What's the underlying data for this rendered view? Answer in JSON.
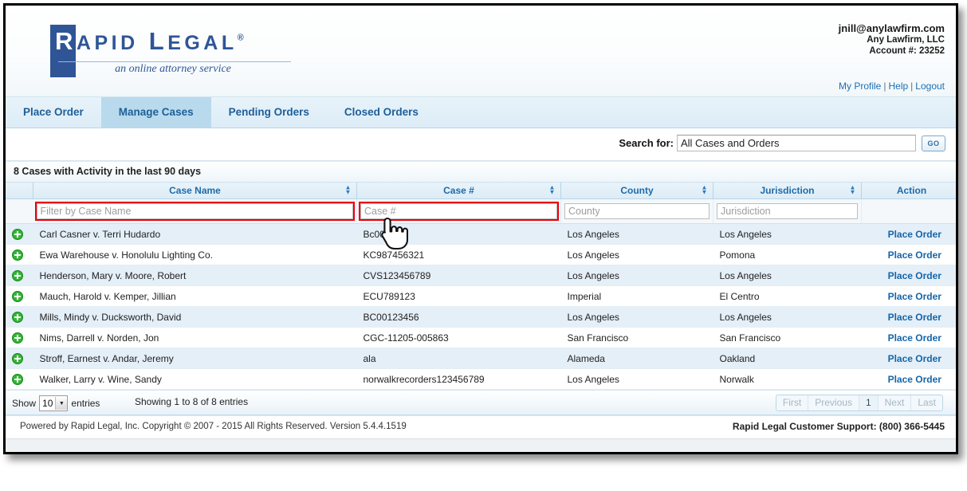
{
  "account": {
    "email": "jnill@anylawfirm.com",
    "firm": "Any Lawfirm, LLC",
    "account_number": "Account #: 23252",
    "links": [
      {
        "label": "My Profile"
      },
      {
        "label": "Help"
      },
      {
        "label": "Logout"
      }
    ],
    "separator": "|"
  },
  "brand": {
    "name_part1": "R",
    "name_part2": "APID",
    "name_part3": "L",
    "name_part4": "EGAL",
    "registered": "®",
    "tagline": "an online attorney service",
    "primary_color": "#2f5597"
  },
  "tabs": [
    {
      "label": "Place Order",
      "active": false
    },
    {
      "label": "Manage Cases",
      "active": true
    },
    {
      "label": "Pending Orders",
      "active": false
    },
    {
      "label": "Closed Orders",
      "active": false
    }
  ],
  "search": {
    "label": "Search for:",
    "value": "All Cases and Orders",
    "placeholder": "All Cases and Orders",
    "button_label": "GO"
  },
  "panel": {
    "title": "8 Cases with Activity in the last 90 days"
  },
  "table": {
    "columns": [
      {
        "key": "expand",
        "label": "",
        "sortable": false
      },
      {
        "key": "case_name",
        "label": "Case Name",
        "sortable": true
      },
      {
        "key": "case_number",
        "label": "Case #",
        "sortable": true
      },
      {
        "key": "county",
        "label": "County",
        "sortable": true
      },
      {
        "key": "jurisdiction",
        "label": "Jurisdiction",
        "sortable": true
      },
      {
        "key": "action",
        "label": "Action",
        "sortable": false
      }
    ],
    "filters": [
      {
        "key": "case_name",
        "placeholder": "Filter by Case Name",
        "value": "",
        "highlighted": true
      },
      {
        "key": "case_number",
        "placeholder": "Case #",
        "value": "",
        "highlighted": true
      },
      {
        "key": "county",
        "placeholder": "County",
        "value": "",
        "highlighted": false
      },
      {
        "key": "jurisdiction",
        "placeholder": "Jurisdiction",
        "value": "",
        "highlighted": false
      }
    ],
    "action_label": "Place Order",
    "rows": [
      {
        "case_name": "Carl Casner v. Terri Hudardo",
        "case_number": "Bc00987",
        "county": "Los Angeles",
        "jurisdiction": "Los Angeles",
        "action": "Place Order"
      },
      {
        "case_name": "Ewa Warehouse v. Honolulu Lighting Co.",
        "case_number": "KC987456321",
        "county": "Los Angeles",
        "jurisdiction": "Pomona",
        "action": "Place Order"
      },
      {
        "case_name": "Henderson, Mary v. Moore, Robert",
        "case_number": "CVS123456789",
        "county": "Los Angeles",
        "jurisdiction": "Los Angeles",
        "action": "Place Order"
      },
      {
        "case_name": "Mauch, Harold v. Kemper, Jillian",
        "case_number": "ECU789123",
        "county": "Imperial",
        "jurisdiction": "El Centro",
        "action": "Place Order"
      },
      {
        "case_name": "Mills, Mindy v. Ducksworth, David",
        "case_number": "BC00123456",
        "county": "Los Angeles",
        "jurisdiction": "Los Angeles",
        "action": "Place Order"
      },
      {
        "case_name": "Nims, Darrell v. Norden, Jon",
        "case_number": "CGC-11205-005863",
        "county": "San Francisco",
        "jurisdiction": "San Francisco",
        "action": "Place Order"
      },
      {
        "case_name": "Stroff, Earnest v. Andar, Jeremy",
        "case_number": "ala",
        "county": "Alameda",
        "jurisdiction": "Oakland",
        "action": "Place Order"
      },
      {
        "case_name": "Walker, Larry v. Wine, Sandy",
        "case_number": "norwalkrecorders123456789",
        "county": "Los Angeles",
        "jurisdiction": "Norwalk",
        "action": "Place Order"
      }
    ]
  },
  "grid_footer": {
    "show_prefix": "Show",
    "page_size": "10",
    "show_suffix": "entries",
    "showing_text": "Showing 1 to 8 of 8 entries",
    "pager": [
      {
        "label": "First",
        "state": "disabled"
      },
      {
        "label": "Previous",
        "state": "disabled"
      },
      {
        "label": "1",
        "state": "current"
      },
      {
        "label": "Next",
        "state": "disabled"
      },
      {
        "label": "Last",
        "state": "disabled"
      }
    ]
  },
  "footer": {
    "left": "Powered by Rapid Legal, Inc. Copyright © 2007 - 2015 All Rights Reserved.  Version 5.4.4.1519",
    "right": "Rapid Legal Customer Support: (800) 366-5445"
  }
}
